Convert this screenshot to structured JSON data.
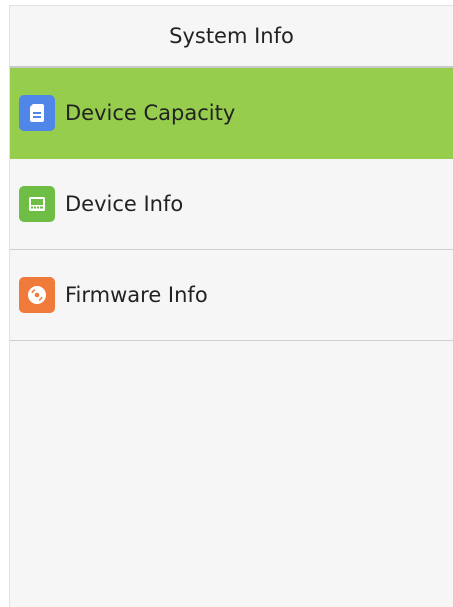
{
  "header": {
    "title": "System Info"
  },
  "menu": {
    "items": [
      {
        "label": "Device Capacity",
        "icon": "storage-card-icon",
        "icon_color": "#4f86e8",
        "selected": true
      },
      {
        "label": "Device Info",
        "icon": "device-icon",
        "icon_color": "#6ebd45",
        "selected": false
      },
      {
        "label": "Firmware Info",
        "icon": "disc-icon",
        "icon_color": "#ef7a3a",
        "selected": false
      }
    ]
  },
  "colors": {
    "selected_background": "#96cd4d",
    "background": "#f6f6f6"
  }
}
